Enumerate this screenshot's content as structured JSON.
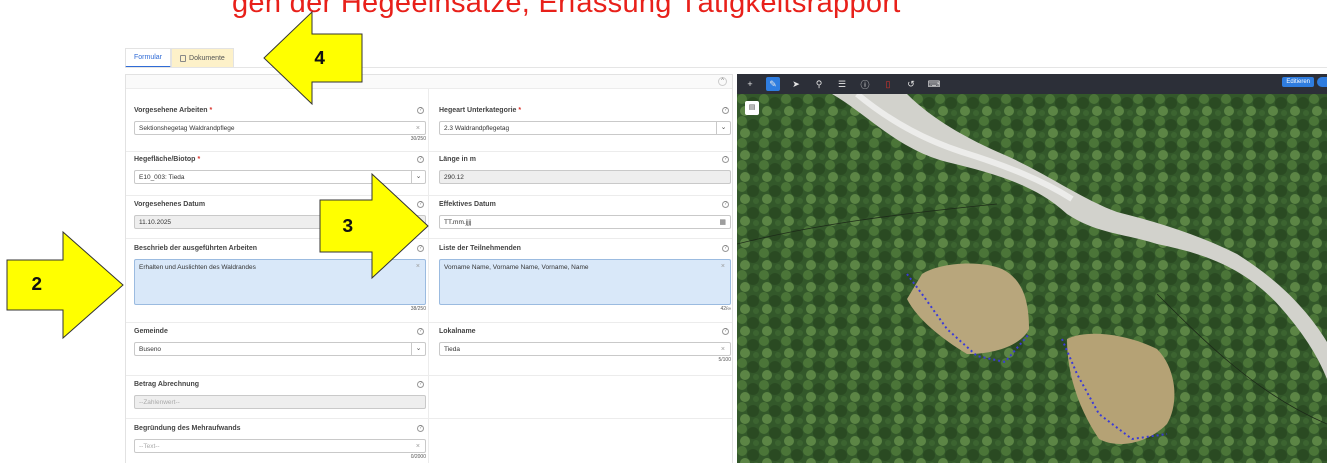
{
  "caption": "gen der Hegeeinsätze, Erfassung Tätigkeitsrapport",
  "tabs": [
    {
      "label": "Formular"
    },
    {
      "label": "Dokumente"
    }
  ],
  "form": {
    "vorgesehene_arbeiten": {
      "label": "Vorgesehene Arbeiten",
      "req": "*",
      "value": "Sektionshegetag Waldrandpflege",
      "counter": "30/250"
    },
    "hegeart": {
      "label": "Hegeart Unterkategorie",
      "req": "*",
      "value": "2.3 Waldrandpflegetag"
    },
    "hegeflaeche": {
      "label": "Hegefläche/Biotop",
      "req": "*",
      "value": "E10_003: Tieda"
    },
    "laenge": {
      "label": "Länge in m",
      "value": "290.12"
    },
    "vorgesehenes_datum": {
      "label": "Vorgesehenes Datum",
      "value": "11.10.2025"
    },
    "effektives_datum": {
      "label": "Effektives Datum",
      "placeholder": "TT.mm.jjjj"
    },
    "beschrieb": {
      "label": "Beschrieb der ausgeführten Arbeiten",
      "value": "Erhalten und Auslichten des Waldrandes",
      "counter": "38/250"
    },
    "teilnehmende": {
      "label": "Liste der Teilnehmenden",
      "value": "Vorname Name, Vorname Name, Vorname, Name",
      "counter": "42/∞"
    },
    "gemeinde": {
      "label": "Gemeinde",
      "value": "Buseno"
    },
    "lokalname": {
      "label": "Lokalname",
      "value": "Tieda",
      "counter": "5/100"
    },
    "betrag": {
      "label": "Betrag Abrechnung",
      "placeholder": "--Zahlenwert--"
    },
    "begruendung": {
      "label": "Begründung des Mehraufwands",
      "placeholder": "--Text--",
      "counter": "0/2000"
    }
  },
  "map": {
    "toolbar_icons": [
      "plus-icon",
      "edit-icon",
      "pointer-icon",
      "route-icon",
      "list-icon",
      "info-icon",
      "delete-icon",
      "undo-icon",
      "keyboard-icon"
    ],
    "edit_label": "Editieren"
  },
  "callouts": [
    {
      "number": "4"
    },
    {
      "number": "3"
    },
    {
      "number": "2"
    }
  ],
  "colors": {
    "accent": "#2f7de0",
    "required": "#d9322b",
    "callout_fill": "#ffff00",
    "caption": "#e8201a"
  }
}
